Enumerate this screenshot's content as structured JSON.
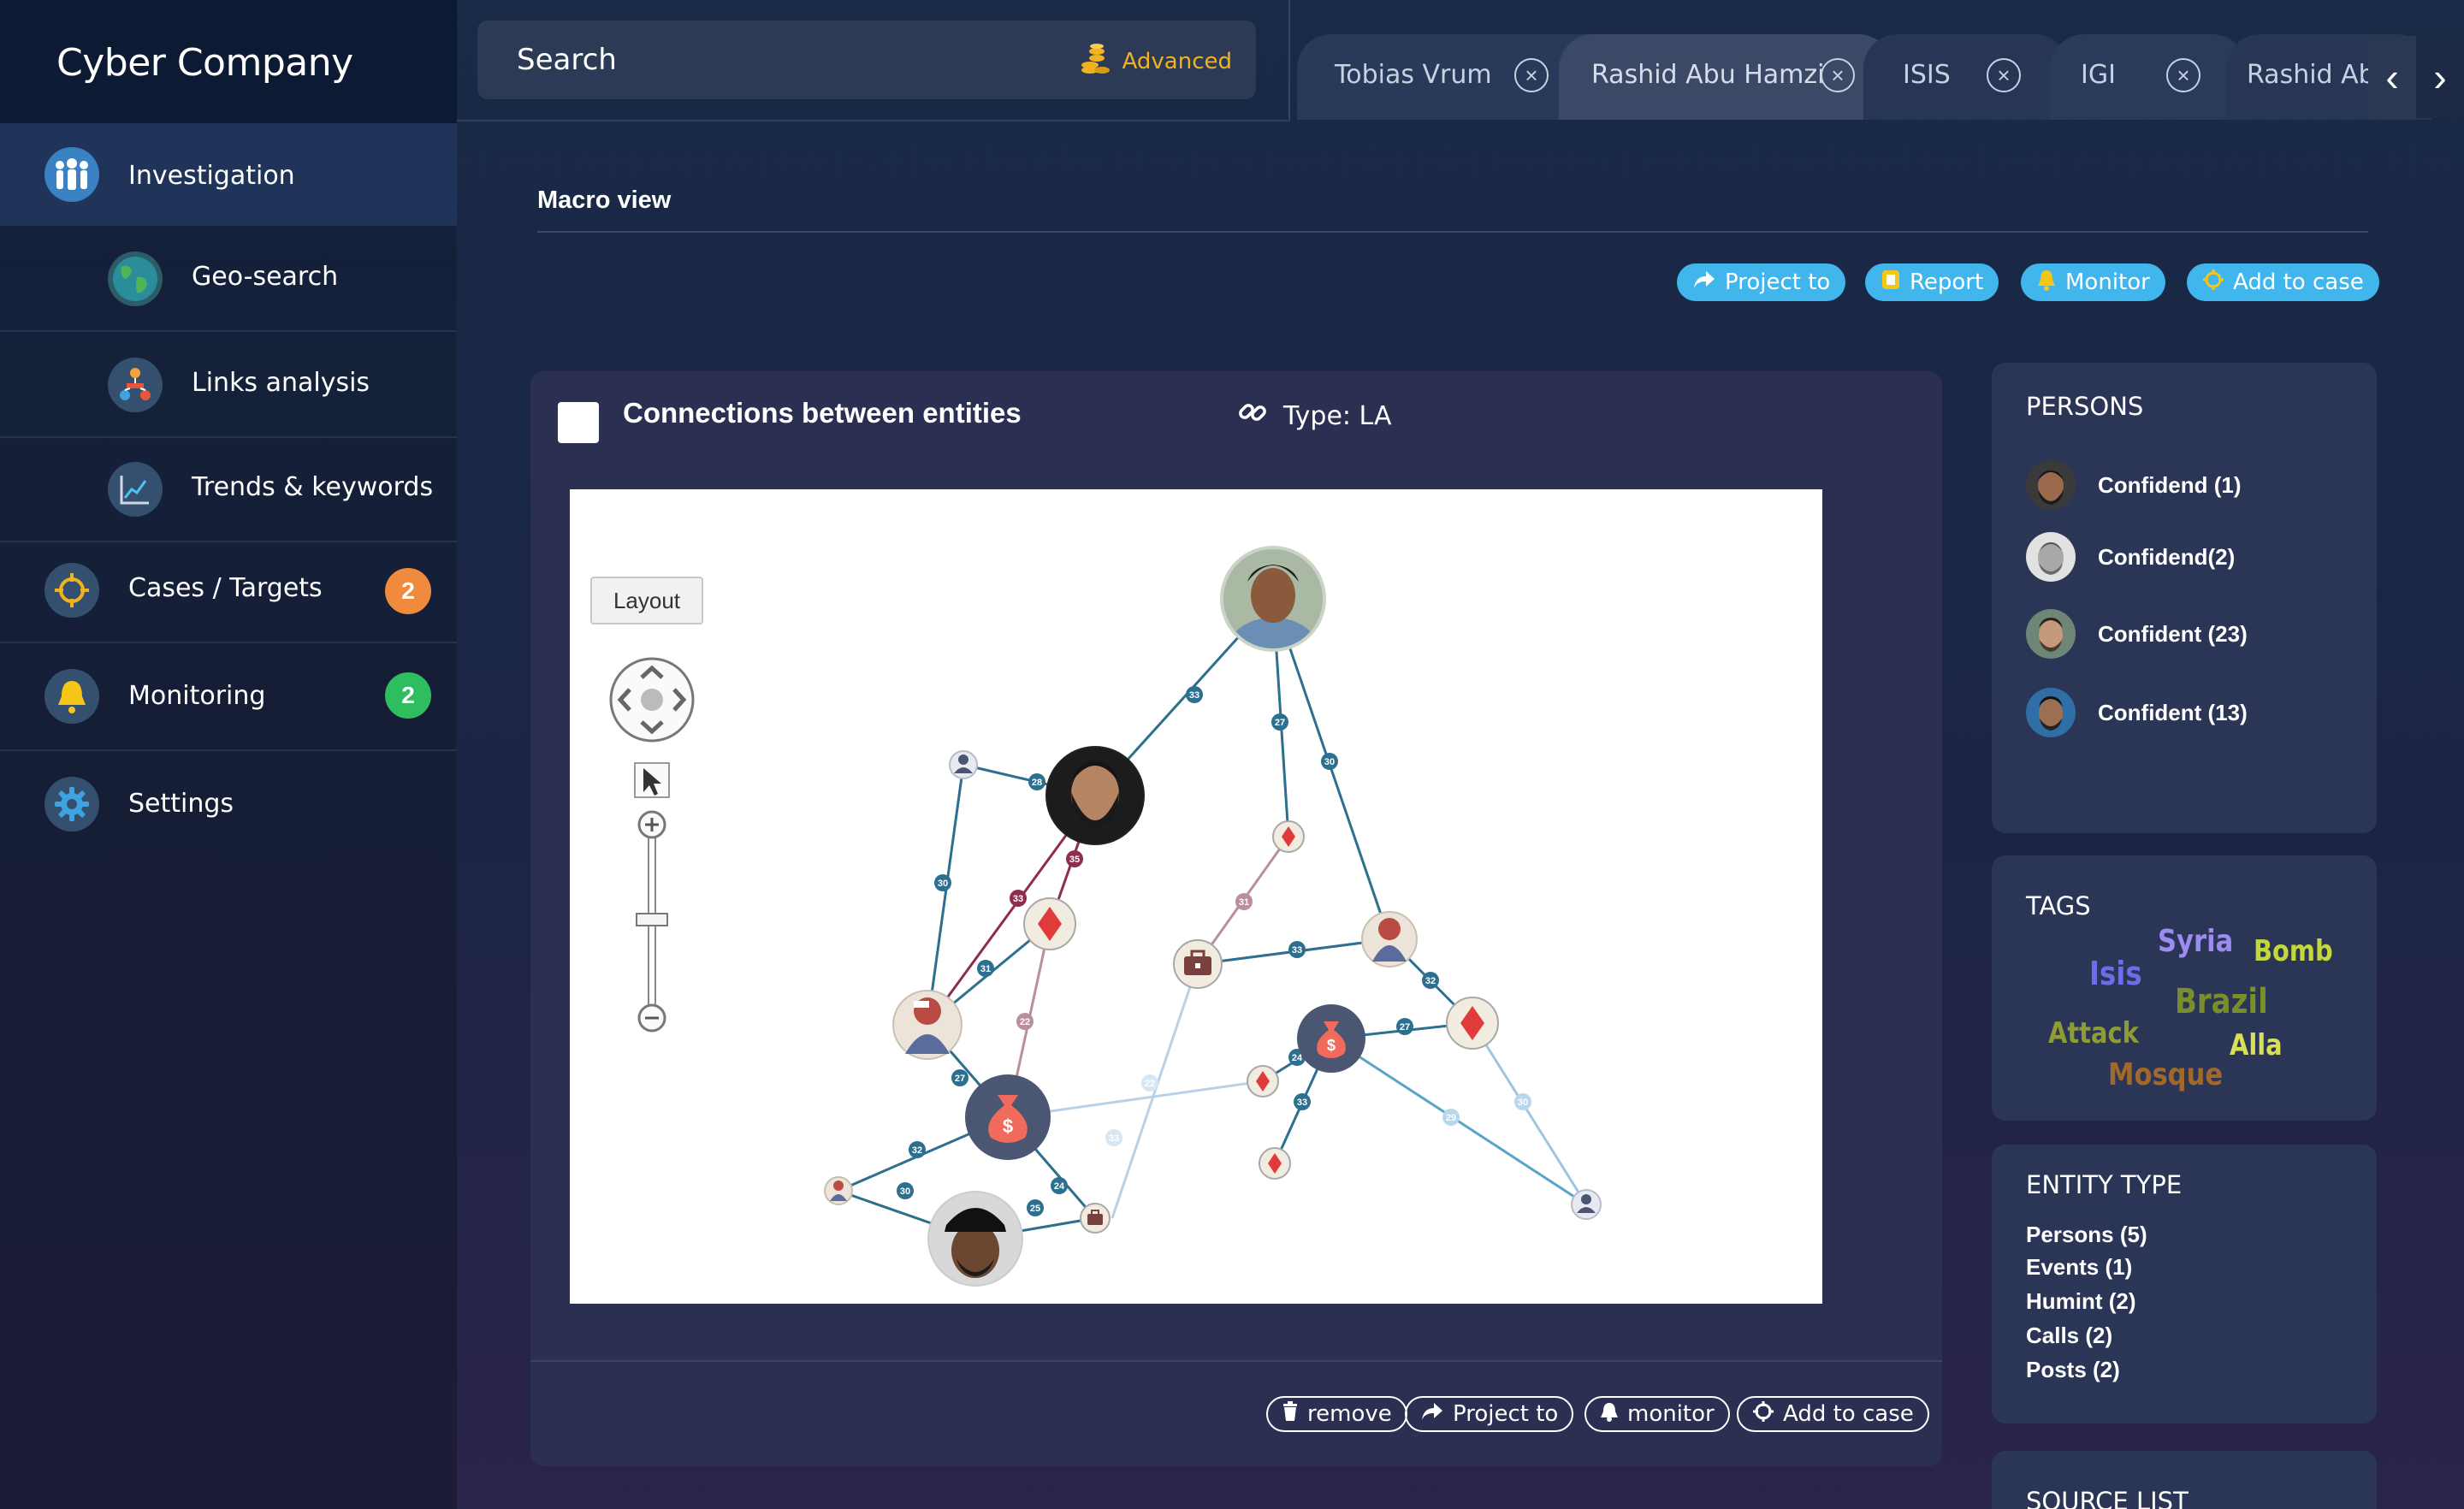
{
  "app": {
    "title": "Cyber Company"
  },
  "sidebar": {
    "items": [
      {
        "label": "Investigation",
        "icon": "people-icon",
        "active": true
      },
      {
        "label": "Geo-search",
        "icon": "globe-icon"
      },
      {
        "label": "Links analysis",
        "icon": "network-icon"
      },
      {
        "label": "Trends & keywords",
        "icon": "chart-icon"
      },
      {
        "label": "Cases / Targets",
        "icon": "crosshair-icon",
        "badge": "2",
        "badge_color": "#f08a3c"
      },
      {
        "label": "Monitoring",
        "icon": "bell-icon",
        "badge": "2",
        "badge_color": "#2ebd5f"
      },
      {
        "label": "Settings",
        "icon": "gear-icon"
      }
    ]
  },
  "search": {
    "label": "Search",
    "advanced": "Advanced"
  },
  "tabs": [
    {
      "label": "Tobias Vrum"
    },
    {
      "label": "Rashid Abu Hamzi",
      "active": true
    },
    {
      "label": "ISIS"
    },
    {
      "label": "IGI"
    },
    {
      "label": "Rashid Abu"
    }
  ],
  "main": {
    "title": "Macro view",
    "actions": [
      {
        "label": "Project to",
        "icon": "share-icon"
      },
      {
        "label": "Report",
        "icon": "report-icon"
      },
      {
        "label": "Monitor",
        "icon": "bell-icon"
      },
      {
        "label": "Add to case",
        "icon": "crosshair-icon"
      }
    ]
  },
  "connections": {
    "title": "Connections between entities",
    "type_label": "Type: LA",
    "layout_button": "Layout",
    "edge_labels": [
      "33",
      "27",
      "30",
      "28",
      "35",
      "33",
      "31",
      "30",
      "31",
      "33",
      "32",
      "22",
      "27",
      "27",
      "24",
      "32",
      "30",
      "25",
      "24",
      "33",
      "22",
      "33",
      "29",
      "30",
      "33"
    ],
    "footer": [
      {
        "label": "remove",
        "icon": "trash-icon"
      },
      {
        "label": "Project to",
        "icon": "share-icon"
      },
      {
        "label": "monitor",
        "icon": "bell-icon"
      },
      {
        "label": "Add to case",
        "icon": "crosshair-icon"
      }
    ]
  },
  "persons": {
    "title": "PERSONS",
    "items": [
      {
        "name": "Confidend (1)"
      },
      {
        "name": "Confidend(2)"
      },
      {
        "name": "Confident (23)"
      },
      {
        "name": "Confident (13)"
      }
    ]
  },
  "tags": {
    "title": "TAGS",
    "items": [
      {
        "text": "Syria",
        "color": "#9c8cf0"
      },
      {
        "text": "Bomb",
        "color": "#c5d83b"
      },
      {
        "text": "Isis",
        "color": "#6e6ce8"
      },
      {
        "text": "Brazil",
        "color": "#7a8f2c"
      },
      {
        "text": "Attack",
        "color": "#8f9c34"
      },
      {
        "text": "Alla",
        "color": "#d8e05a"
      },
      {
        "text": "Mosque",
        "color": "#a0682a"
      }
    ]
  },
  "entity_type": {
    "title": "ENTITY TYPE",
    "items": [
      "Persons (5)",
      "Events (1)",
      "Humint (2)",
      "Calls (2)",
      "Posts (2)"
    ]
  },
  "source_list": {
    "title": "SOURCE LIST"
  }
}
